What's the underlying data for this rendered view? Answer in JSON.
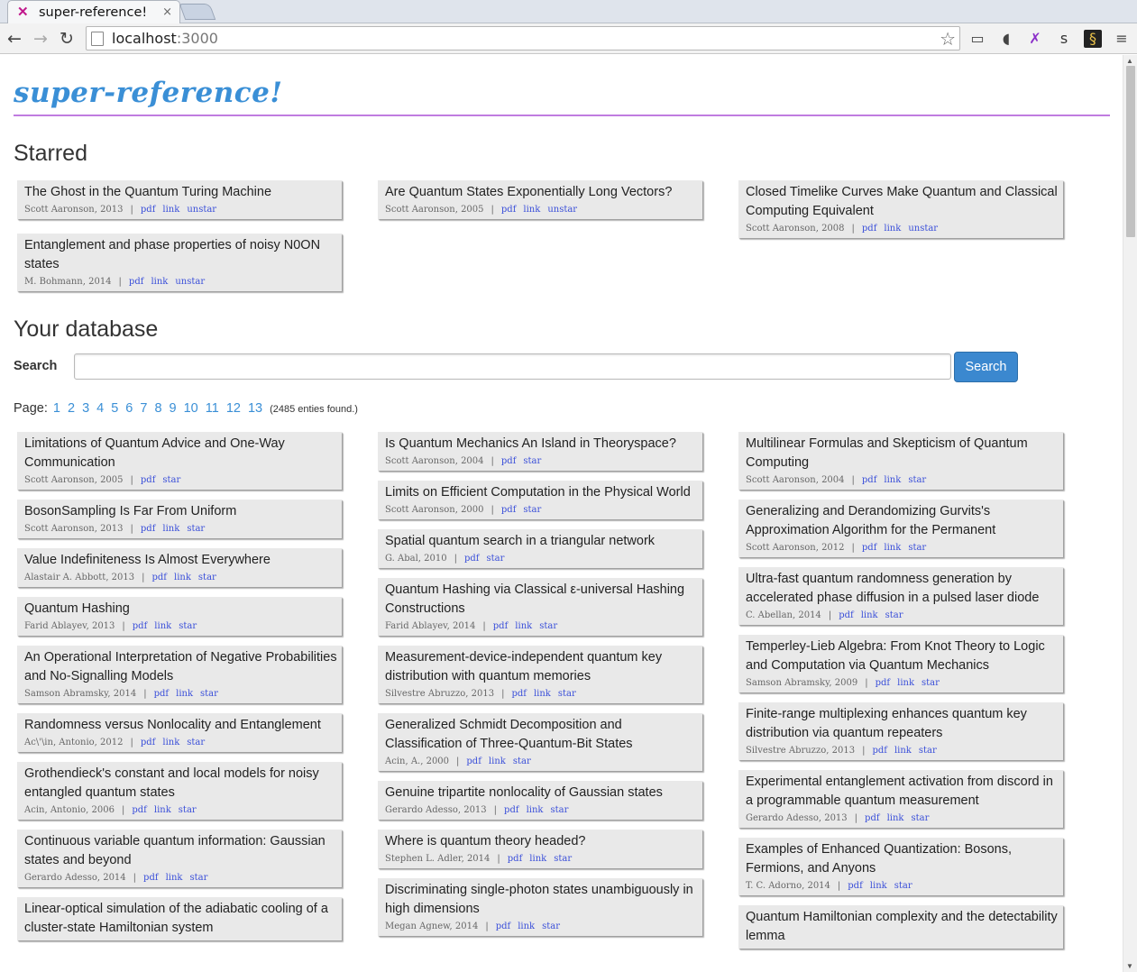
{
  "browser": {
    "tab_title": "super-reference!",
    "tab_close": "×",
    "url_host": "localhost",
    "url_port": ":3000"
  },
  "page": {
    "brand": "super-reference!",
    "starred_heading": "Starred",
    "database_heading": "Your database",
    "search_label": "Search",
    "search_value": "",
    "search_button": "Search",
    "page_label": "Page:",
    "pages": [
      "1",
      "2",
      "3",
      "4",
      "5",
      "6",
      "7",
      "8",
      "9",
      "10",
      "11",
      "12",
      "13"
    ],
    "entries_found": "(2485 enties found.)"
  },
  "starred": [
    {
      "title": "The Ghost in the Quantum Turing Machine",
      "meta": "Scott Aaronson, 2013",
      "links": [
        "pdf",
        "link",
        "unstar"
      ]
    },
    {
      "title": "Are Quantum States Exponentially Long Vectors?",
      "meta": "Scott Aaronson, 2005",
      "links": [
        "pdf",
        "link",
        "unstar"
      ]
    },
    {
      "title": "Closed Timelike Curves Make Quantum and Classical Computing Equivalent",
      "meta": "Scott Aaronson, 2008",
      "links": [
        "pdf",
        "link",
        "unstar"
      ]
    },
    {
      "title": "Entanglement and phase properties of noisy N0ON states",
      "meta": "M. Bohmann, 2014",
      "links": [
        "pdf",
        "link",
        "unstar"
      ]
    }
  ],
  "database": [
    {
      "title": "Limitations of Quantum Advice and One-Way Communication",
      "meta": "Scott Aaronson, 2005",
      "links": [
        "pdf",
        "star"
      ]
    },
    {
      "title": "Is Quantum Mechanics An Island in Theoryspace?",
      "meta": "Scott Aaronson, 2004",
      "links": [
        "pdf",
        "star"
      ]
    },
    {
      "title": "Multilinear Formulas and Skepticism of Quantum Computing",
      "meta": "Scott Aaronson, 2004",
      "links": [
        "pdf",
        "link",
        "star"
      ]
    },
    {
      "title": "BosonSampling Is Far From Uniform",
      "meta": "Scott Aaronson, 2013",
      "links": [
        "pdf",
        "link",
        "star"
      ]
    },
    {
      "title": "Limits on Efficient Computation in the Physical World",
      "meta": "Scott Aaronson, 2000",
      "links": [
        "pdf",
        "star"
      ]
    },
    {
      "title": "Generalizing and Derandomizing Gurvits's Approximation Algorithm for the Permanent",
      "meta": "Scott Aaronson, 2012",
      "links": [
        "pdf",
        "link",
        "star"
      ]
    },
    {
      "title": "Value Indefiniteness Is Almost Everywhere",
      "meta": "Alastair A. Abbott, 2013",
      "links": [
        "pdf",
        "link",
        "star"
      ]
    },
    {
      "title": "Spatial quantum search in a triangular network",
      "meta": "G. Abal, 2010",
      "links": [
        "pdf",
        "star"
      ]
    },
    {
      "title": "Ultra-fast quantum randomness generation by accelerated phase diffusion in a pulsed laser diode",
      "meta": "C. Abellan, 2014",
      "links": [
        "pdf",
        "link",
        "star"
      ]
    },
    {
      "title": "Quantum Hashing",
      "meta": "Farid Ablayev, 2013",
      "links": [
        "pdf",
        "link",
        "star"
      ]
    },
    {
      "title": "Quantum Hashing via Classical ε-universal Hashing Constructions",
      "meta": "Farid Ablayev, 2014",
      "links": [
        "pdf",
        "link",
        "star"
      ]
    },
    {
      "title": "Temperley-Lieb Algebra: From Knot Theory to Logic and Computation via Quantum Mechanics",
      "meta": "Samson Abramsky, 2009",
      "links": [
        "pdf",
        "link",
        "star"
      ]
    },
    {
      "title": "An Operational Interpretation of Negative Probabilities and No-Signalling Models",
      "meta": "Samson Abramsky, 2014",
      "links": [
        "pdf",
        "link",
        "star"
      ]
    },
    {
      "title": "Measurement-device-independent quantum key distribution with quantum memories",
      "meta": "Silvestre Abruzzo, 2013",
      "links": [
        "pdf",
        "link",
        "star"
      ]
    },
    {
      "title": "Finite-range multiplexing enhances quantum key distribution via quantum repeaters",
      "meta": "Silvestre Abruzzo, 2013",
      "links": [
        "pdf",
        "link",
        "star"
      ]
    },
    {
      "title": "Randomness versus Nonlocality and Entanglement",
      "meta": "Ac\\'\\in, Antonio, 2012",
      "links": [
        "pdf",
        "link",
        "star"
      ]
    },
    {
      "title": "Generalized Schmidt Decomposition and Classification of Three-Quantum-Bit States",
      "meta": "Acin, A., 2000",
      "links": [
        "pdf",
        "link",
        "star"
      ]
    },
    {
      "title": "Experimental entanglement activation from discord in a programmable quantum measurement",
      "meta": "Gerardo Adesso, 2013",
      "links": [
        "pdf",
        "link",
        "star"
      ]
    },
    {
      "title": "Grothendieck's constant and local models for noisy entangled quantum states",
      "meta": "Acin, Antonio, 2006",
      "links": [
        "pdf",
        "link",
        "star"
      ]
    },
    {
      "title": "Genuine tripartite nonlocality of Gaussian states",
      "meta": "Gerardo Adesso, 2013",
      "links": [
        "pdf",
        "link",
        "star"
      ]
    },
    {
      "title": "Examples of Enhanced Quantization: Bosons, Fermions, and Anyons",
      "meta": "T. C. Adorno, 2014",
      "links": [
        "pdf",
        "link",
        "star"
      ]
    },
    {
      "title": "Continuous variable quantum information: Gaussian states and beyond",
      "meta": "Gerardo Adesso, 2014",
      "links": [
        "pdf",
        "link",
        "star"
      ]
    },
    {
      "title": "Where is quantum theory headed?",
      "meta": "Stephen L. Adler, 2014",
      "links": [
        "pdf",
        "link",
        "star"
      ]
    },
    {
      "title": "Quantum Hamiltonian complexity and the detectability lemma",
      "meta": "",
      "links": []
    },
    {
      "title": "Linear-optical simulation of the adiabatic cooling of a cluster-state Hamiltonian system",
      "meta": "",
      "links": []
    },
    {
      "title": "Discriminating single-photon states unambiguously in high dimensions",
      "meta": "Megan Agnew, 2014",
      "links": [
        "pdf",
        "link",
        "star"
      ]
    }
  ]
}
